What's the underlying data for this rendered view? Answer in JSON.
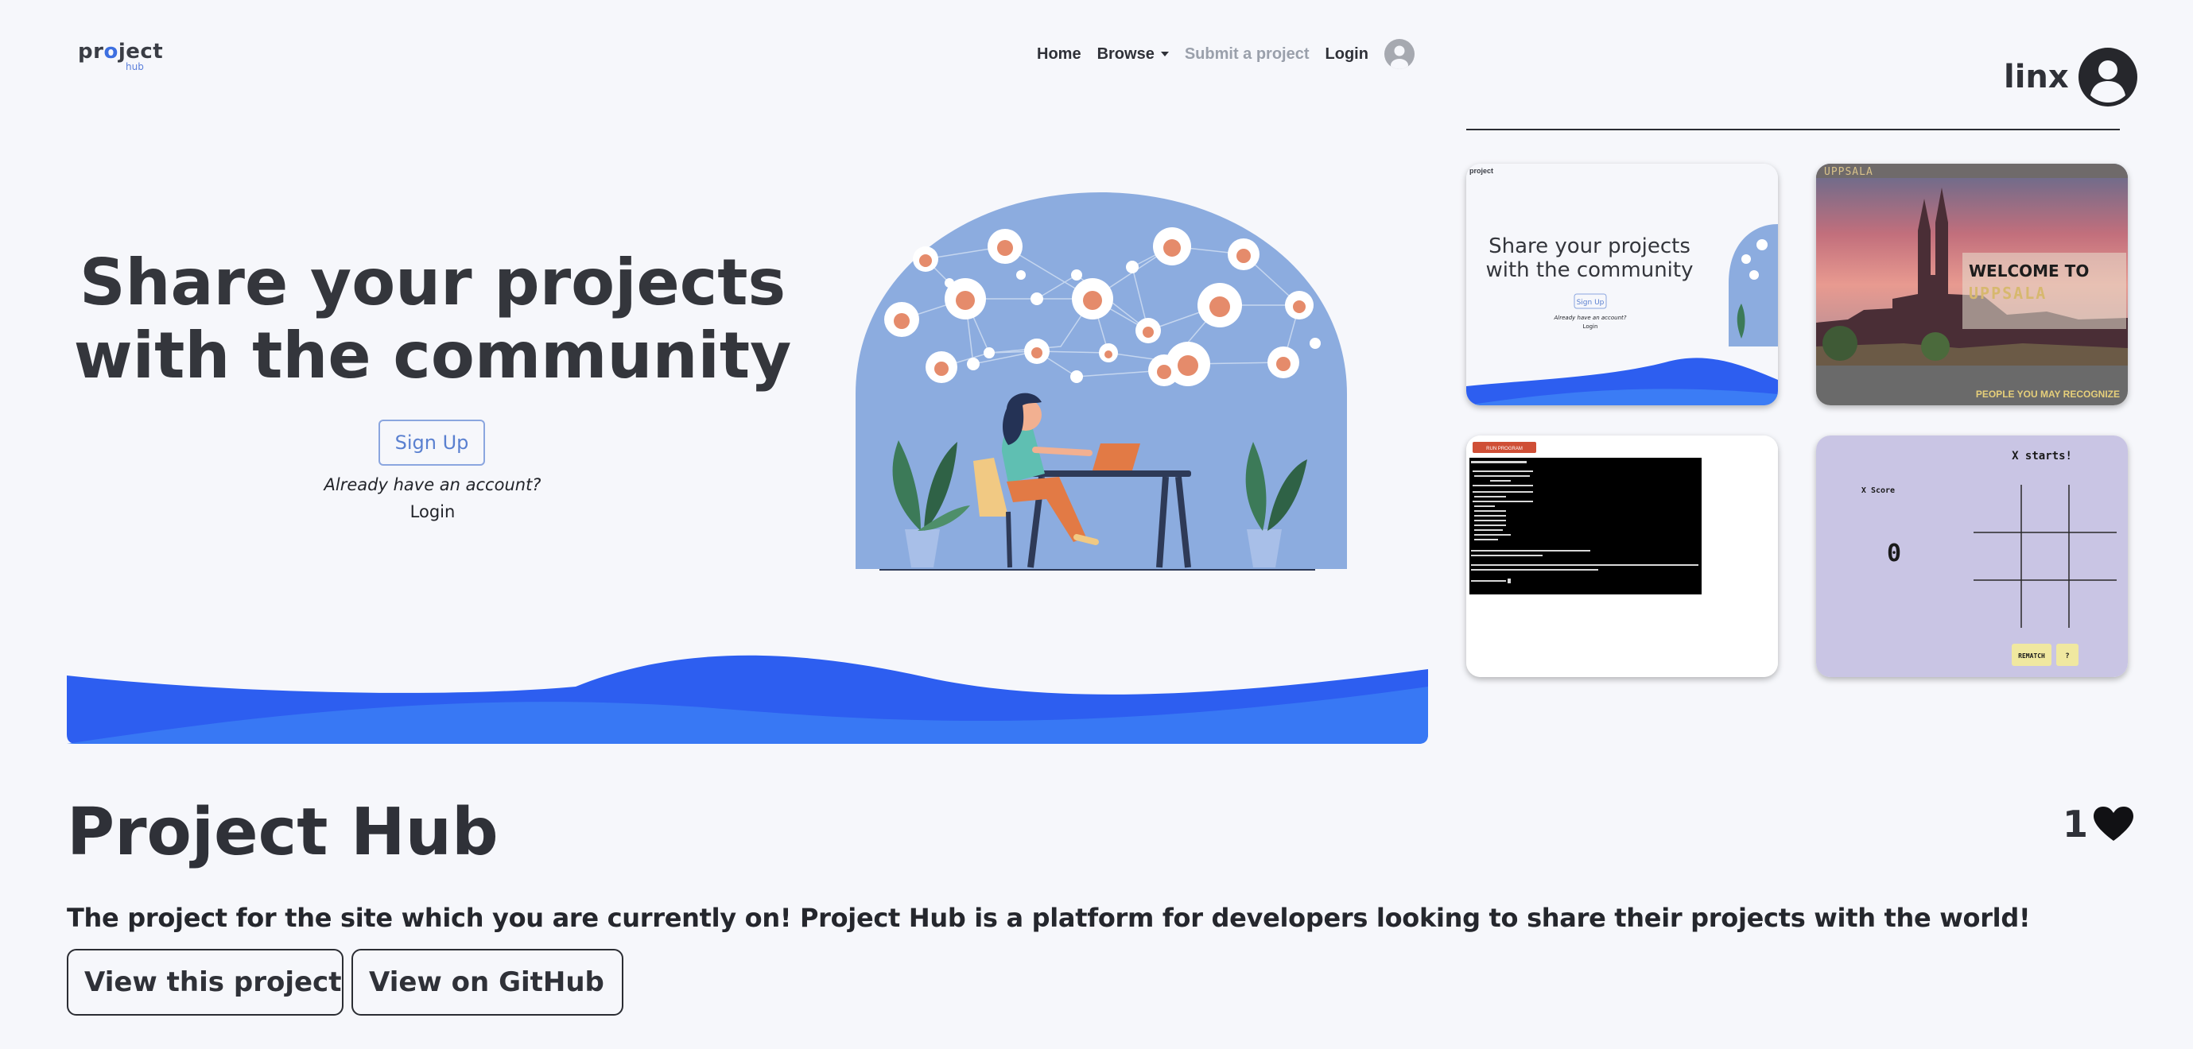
{
  "hero": {
    "logo_main_pre": "pr",
    "logo_main_o": "o",
    "logo_main_post": "ject",
    "logo_sub": "hub",
    "nav": {
      "home": "Home",
      "browse": "Browse",
      "submit": "Submit a project",
      "login": "Login"
    },
    "title_line1": "Share your projects",
    "title_line2": "with the community",
    "signup_label": "Sign Up",
    "already_text": "Already have an account?",
    "login_label": "Login"
  },
  "user": {
    "name": "linx"
  },
  "gallery": {
    "card1": {
      "logo": "project",
      "title_line1": "Share your projects",
      "title_line2": "with the community",
      "signup": "Sign Up",
      "already": "Already have an account?",
      "login": "Login"
    },
    "card2": {
      "brand": "UPPSALA",
      "welcome": "WELCOME TO",
      "city": "UPPSALA",
      "footer": "PEOPLE YOU MAY RECOGNIZE"
    },
    "card3": {
      "run_button": "RUN PROGRAM"
    },
    "card4": {
      "status": "X starts!",
      "score_label": "X Score",
      "score_value": "0",
      "rematch": "REMATCH",
      "help": "?"
    }
  },
  "project": {
    "title": "Project Hub",
    "likes": "1",
    "description": "The project for the site which you are currently on! Project Hub is a platform for developers looking to share their projects with the world!",
    "view_project_label": "View this project",
    "view_github_label": "View on GitHub"
  },
  "colors": {
    "background": "#f6f7fb",
    "accent_blue": "#2f63ef",
    "illustration_blue": "#8cacdf",
    "text_dark": "#2f3138",
    "tictactoe_bg": "#c9c5e4"
  },
  "icons": {
    "user_avatar": "user-circle-icon",
    "like": "heart-icon",
    "external_link": "external-link-icon",
    "github": "github-icon"
  }
}
